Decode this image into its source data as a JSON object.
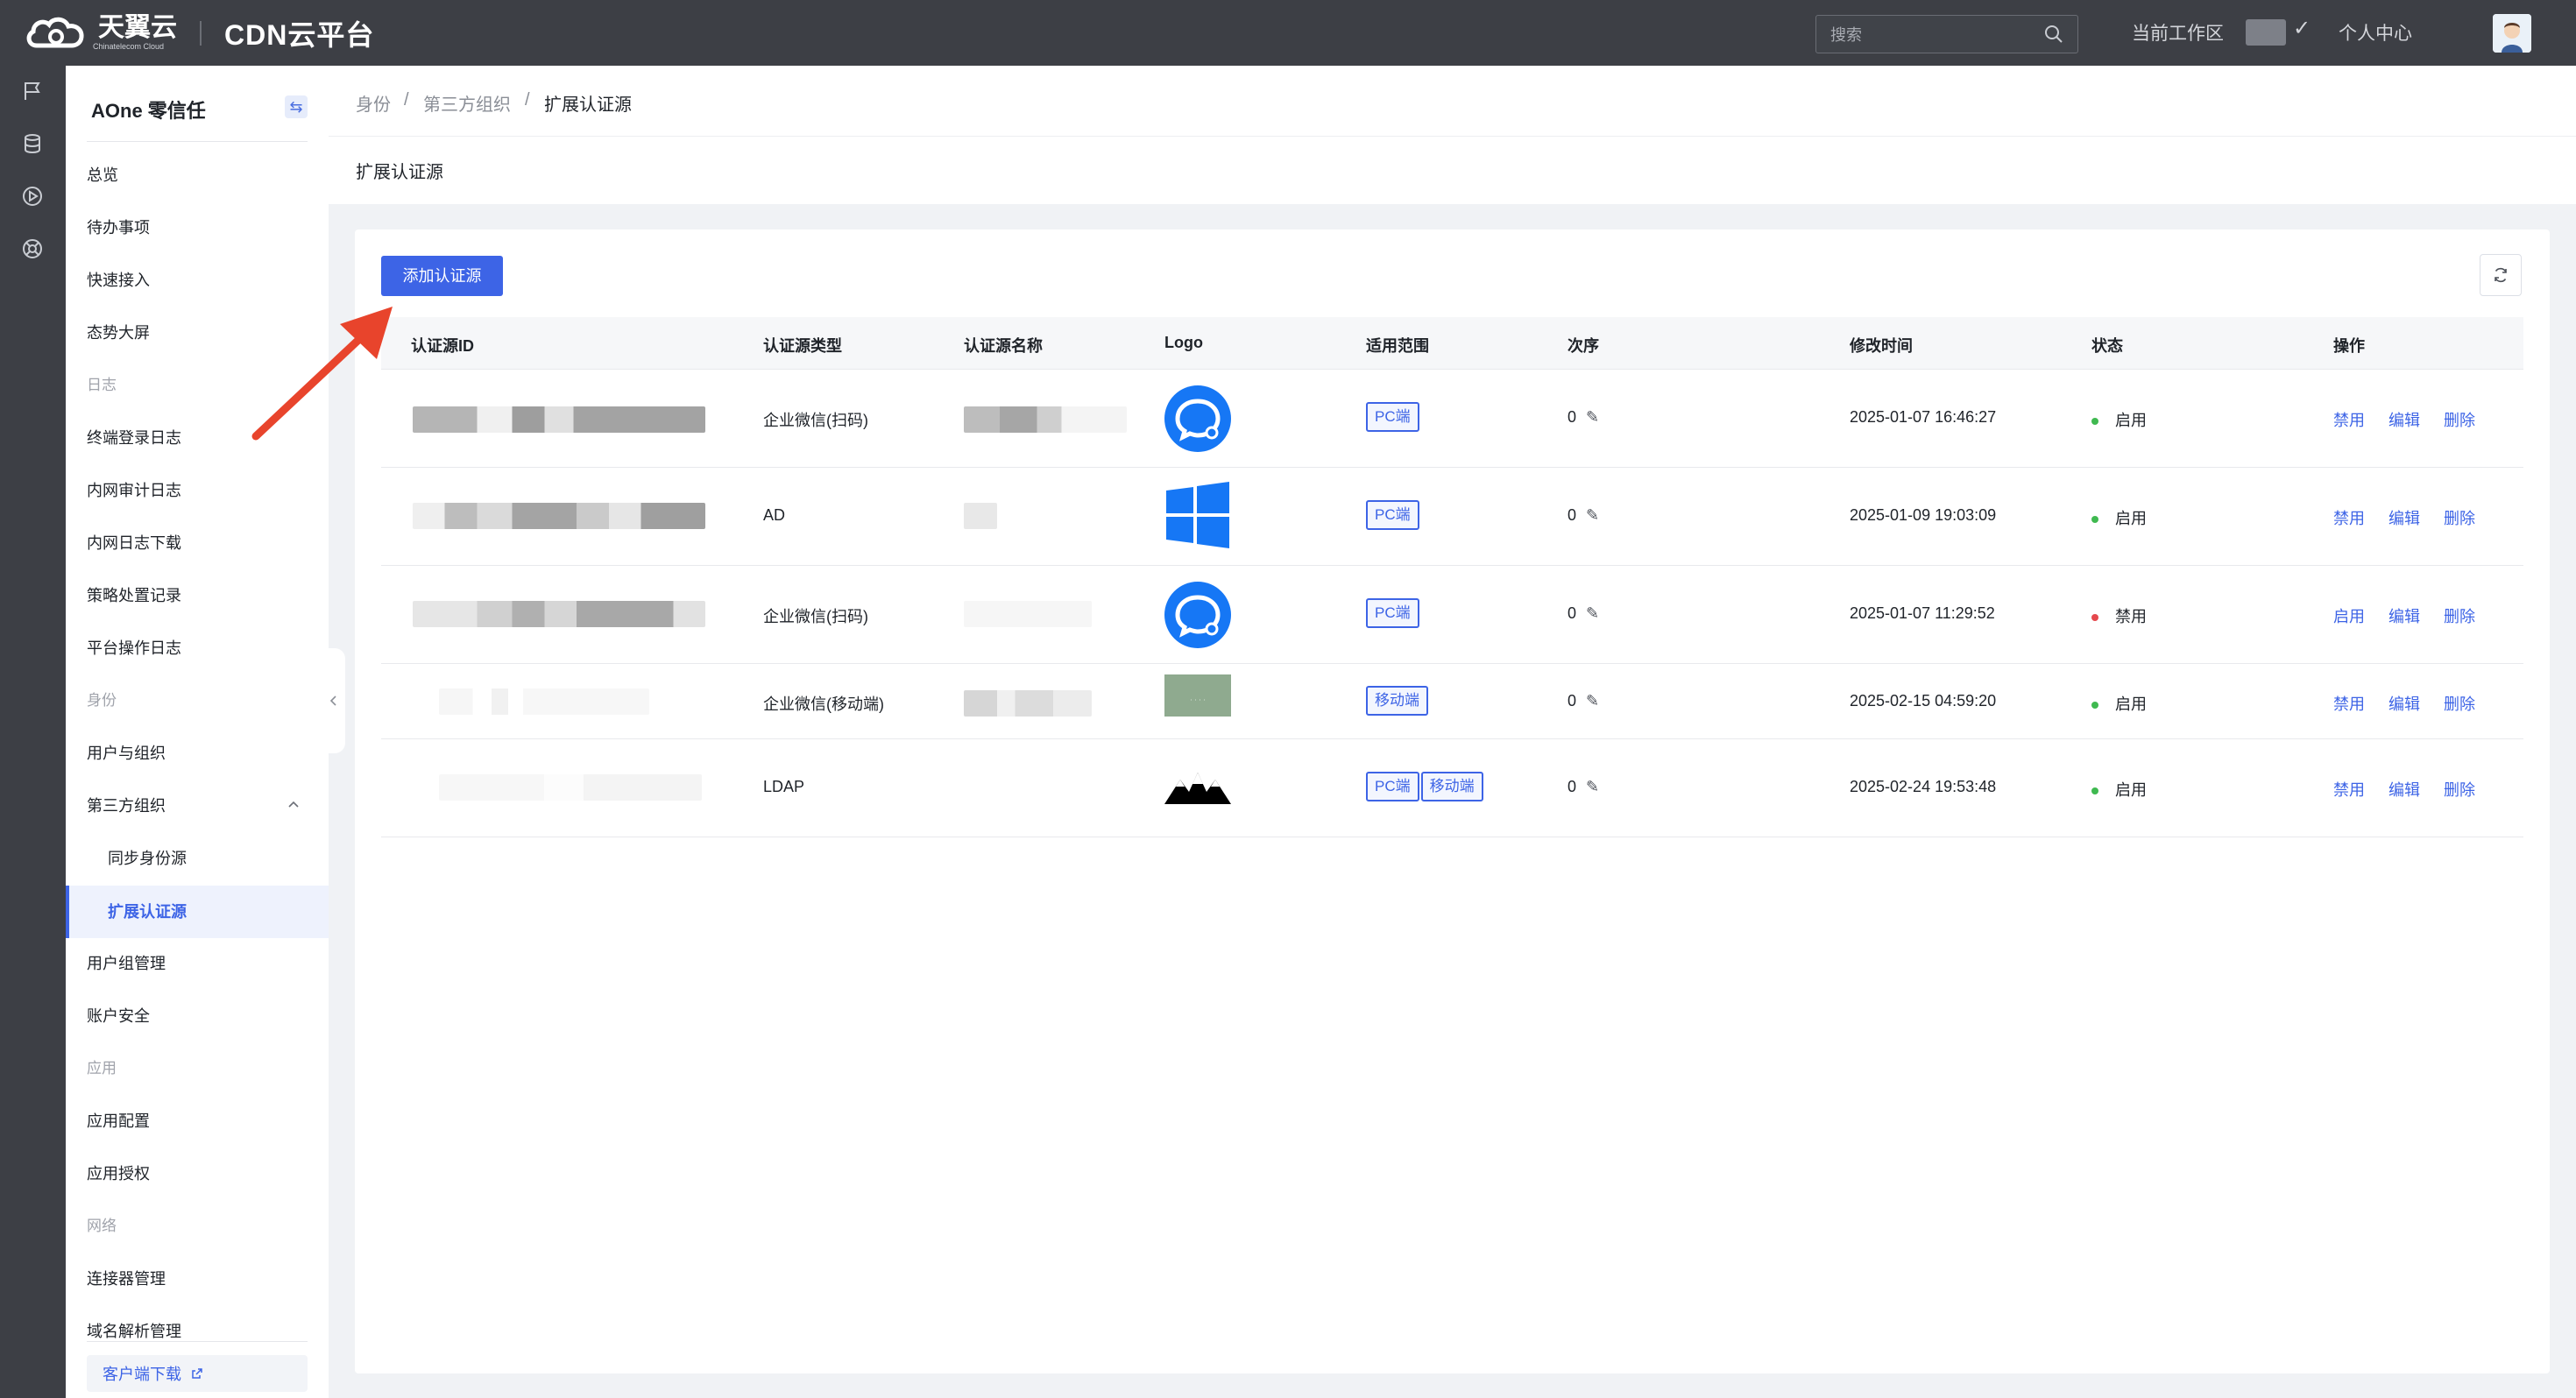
{
  "topbar": {
    "brand_name": "天翼云",
    "brand_sub": "Chinatelecom Cloud",
    "product_title": "CDN云平台",
    "search_placeholder": "搜索",
    "workspace_label": "当前工作区",
    "personal_center": "个人中心"
  },
  "sidebar": {
    "title": "AOne 零信任",
    "items": [
      {
        "type": "item",
        "label": "总览"
      },
      {
        "type": "item",
        "label": "待办事项"
      },
      {
        "type": "item",
        "label": "快速接入"
      },
      {
        "type": "item",
        "label": "态势大屏"
      },
      {
        "type": "group",
        "label": "日志"
      },
      {
        "type": "item",
        "label": "终端登录日志"
      },
      {
        "type": "item",
        "label": "内网审计日志"
      },
      {
        "type": "item",
        "label": "内网日志下载"
      },
      {
        "type": "item",
        "label": "策略处置记录"
      },
      {
        "type": "item",
        "label": "平台操作日志"
      },
      {
        "type": "group",
        "label": "身份"
      },
      {
        "type": "item",
        "label": "用户与组织"
      },
      {
        "type": "item",
        "label": "第三方组织"
      },
      {
        "type": "sub",
        "label": "同步身份源"
      },
      {
        "type": "sub",
        "label": "扩展认证源",
        "active": true
      },
      {
        "type": "item",
        "label": "用户组管理"
      },
      {
        "type": "item",
        "label": "账户安全"
      },
      {
        "type": "group",
        "label": "应用"
      },
      {
        "type": "item",
        "label": "应用配置"
      },
      {
        "type": "item",
        "label": "应用授权"
      },
      {
        "type": "group",
        "label": "网络"
      },
      {
        "type": "item",
        "label": "连接器管理"
      },
      {
        "type": "item",
        "label": "域名解析管理"
      }
    ],
    "download_label": "客户端下载"
  },
  "breadcrumb": {
    "items": [
      "身份",
      "第三方组织",
      "扩展认证源"
    ],
    "separator": "/"
  },
  "page": {
    "title": "扩展认证源",
    "add_button": "添加认证源"
  },
  "table": {
    "columns": [
      "认证源ID",
      "认证源类型",
      "认证源名称",
      "Logo",
      "适用范围",
      "次序",
      "修改时间",
      "状态",
      "操作"
    ],
    "rows": [
      {
        "type": "企业微信(扫码)",
        "logo": "wecom-logo-icon",
        "scope": [
          "PC端"
        ],
        "order": "0",
        "modified": "2025-01-07 16:46:27",
        "status": "启用",
        "status_color": "#3fb950",
        "actions": [
          "禁用",
          "编辑",
          "删除"
        ]
      },
      {
        "type": "AD",
        "logo": "windows-logo-icon",
        "scope": [
          "PC端"
        ],
        "order": "0",
        "modified": "2025-01-09 19:03:09",
        "status": "启用",
        "status_color": "#3fb950",
        "actions": [
          "禁用",
          "编辑",
          "删除"
        ]
      },
      {
        "type": "企业微信(扫码)",
        "logo": "wecom-logo-icon",
        "scope": [
          "PC端"
        ],
        "order": "0",
        "modified": "2025-01-07 11:29:52",
        "status": "禁用",
        "status_color": "#e5484d",
        "actions": [
          "启用",
          "编辑",
          "删除"
        ]
      },
      {
        "type": "企业微信(移动端)",
        "logo": "custom-image-logo-icon",
        "scope": [
          "移动端"
        ],
        "order": "0",
        "modified": "2025-02-15 04:59:20",
        "status": "启用",
        "status_color": "#3fb950",
        "actions": [
          "禁用",
          "编辑",
          "删除"
        ]
      },
      {
        "type": "LDAP",
        "logo": "mountain-logo-icon",
        "scope": [
          "PC端",
          "移动端"
        ],
        "order": "0",
        "modified": "2025-02-24 19:53:48",
        "status": "启用",
        "status_color": "#3fb950",
        "actions": [
          "禁用",
          "编辑",
          "删除"
        ]
      }
    ]
  },
  "colors": {
    "topbar": "#3d3f45",
    "accent": "#3d64e6",
    "arrow": "#e8442c"
  }
}
